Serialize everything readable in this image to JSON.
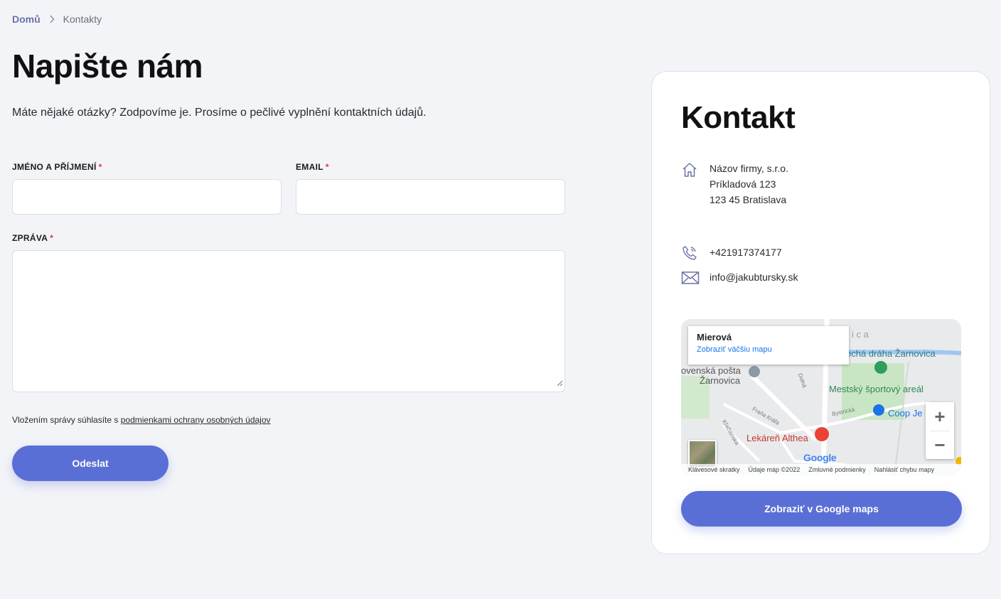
{
  "breadcrumb": {
    "home": "Domů",
    "current": "Kontakty"
  },
  "page": {
    "title": "Napište nám",
    "intro": "Máte nějaké otázky? Zodpovíme je. Prosíme o pečlivé vyplnění kontaktních údajů."
  },
  "form": {
    "name_label": "JMÉNO A PŘÍJMENÍ",
    "email_label": "EMAIL",
    "message_label": "ZPRÁVA",
    "required_mark": "*",
    "name_value": "",
    "email_value": "",
    "message_value": "",
    "consent_prefix": "Vložením správy súhlasíte s ",
    "consent_link": "podmienkami ochrany osobných údajov",
    "submit_label": "Odeslat"
  },
  "contact": {
    "title": "Kontakt",
    "company": "Názov firmy, s.r.o.",
    "street": "Príkladová 123",
    "city": "123 45 Bratislava",
    "phone": "+421917374177",
    "email": "info@jakubtursky.sk",
    "icons": [
      "home-icon",
      "phone-icon",
      "mail-icon"
    ],
    "map_button_label": "Zobraziť v Google maps"
  },
  "map": {
    "popup_title": "Mierová",
    "popup_link": "Zobraziť väčšiu mapu",
    "labels": {
      "post_office_line1": "ovenská pošta",
      "post_office_line2": "Žarnovica",
      "sled_track": "ochá dráha Žarnovica",
      "sports": "Mestský športový areál",
      "coop": "Coop Je",
      "pharmacy": "Lekáreň Althea",
      "street_frana": "Fraňa Kráľa",
      "street_bystricka": "Bystrická",
      "street_dolna": "Dolná",
      "street_klacianska": "Kľačianska",
      "street_partial": "i c a"
    },
    "zoom_in": "+",
    "zoom_out": "−",
    "logo": "Google",
    "footer": {
      "shortcuts": "Klávesové skratky",
      "data": "Údaje máp ©2022",
      "terms": "Zmluvné podmienky",
      "report": "Nahlásiť chybu mapy"
    }
  },
  "colors": {
    "accent": "#5a6fd6",
    "required": "#d63a3a",
    "background": "#f3f4f7",
    "breadcrumb_home": "#6a72a8",
    "map_link": "#1a73e8"
  }
}
